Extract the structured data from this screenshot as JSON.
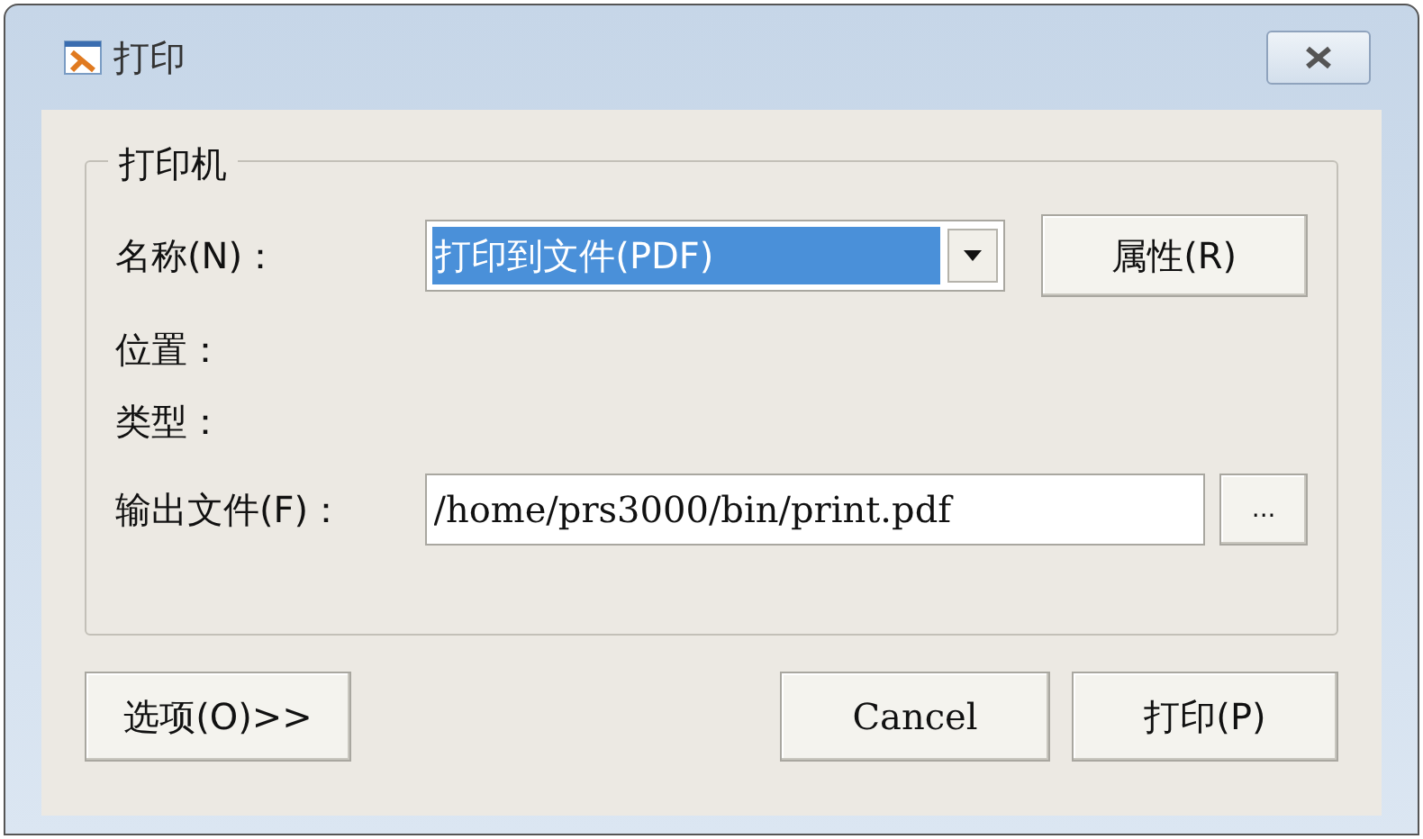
{
  "window": {
    "title": "打印"
  },
  "printer_group": {
    "title": "打印机",
    "name_label": "名称(N)：",
    "name_value": "打印到文件(PDF)",
    "properties_button": "属性(R)",
    "location_label": "位置：",
    "type_label": "类型：",
    "output_label": "输出文件(F)：",
    "output_value": "/home/prs3000/bin/print.pdf",
    "browse_button": "..."
  },
  "buttons": {
    "options": "选项(O)>>",
    "cancel": "Cancel",
    "print": "打印(P)"
  }
}
